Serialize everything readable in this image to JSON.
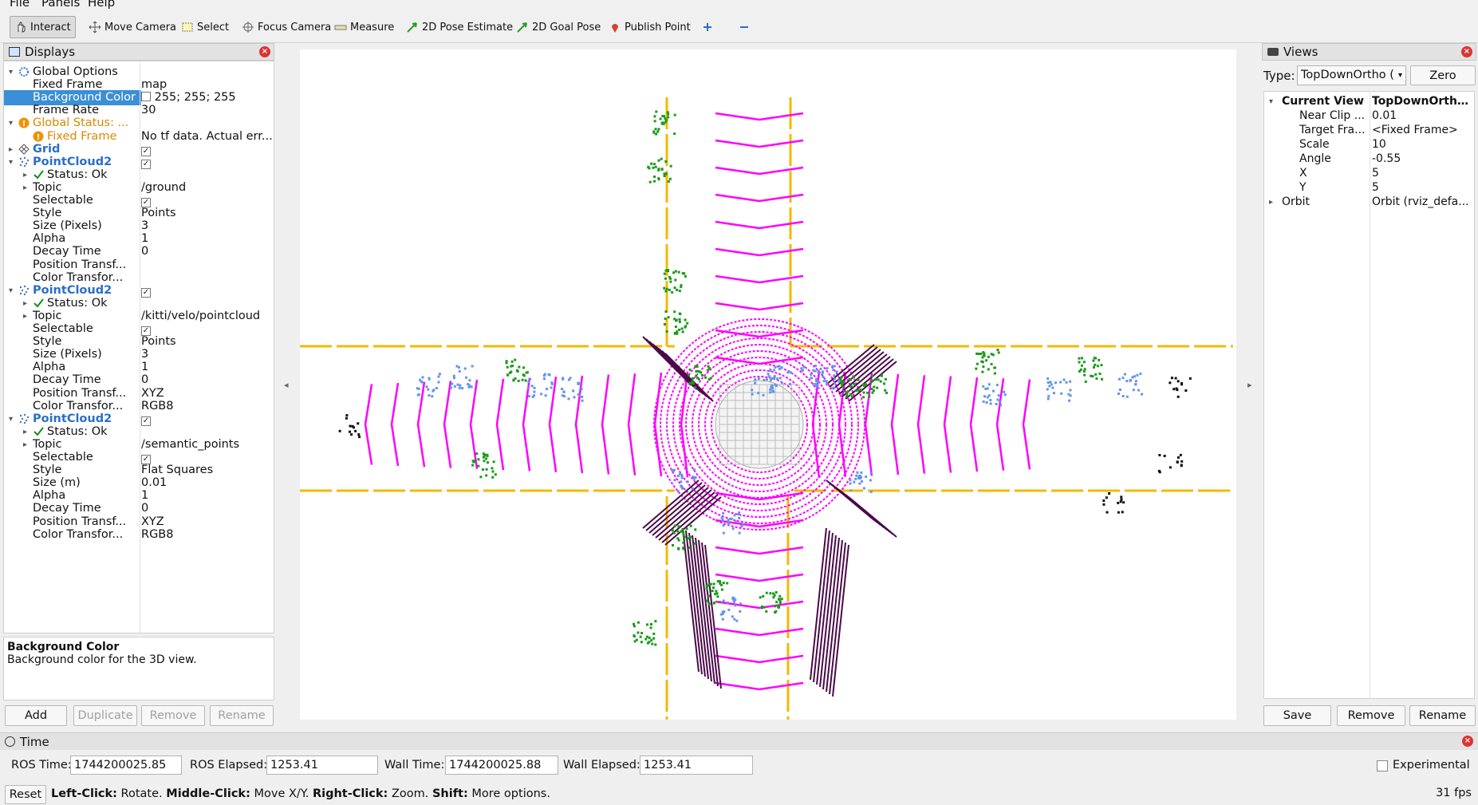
{
  "menu": [
    "File",
    "Panels",
    "Help"
  ],
  "toolbar": {
    "interact": "Interact",
    "move_camera": "Move Camera",
    "select": "Select",
    "focus_camera": "Focus Camera",
    "measure": "Measure",
    "pose_estimate": "2D Pose Estimate",
    "goal_pose": "2D Goal Pose",
    "publish_point": "Publish Point"
  },
  "displays": {
    "title": "Displays",
    "rows": [
      {
        "label": "Global Options",
        "value": ""
      },
      {
        "label": "Fixed Frame",
        "value": "map"
      },
      {
        "label": "Background Color",
        "value": "255; 255; 255"
      },
      {
        "label": "Frame Rate",
        "value": "30"
      },
      {
        "label": "Global Status: ...",
        "value": ""
      },
      {
        "label": "Fixed Frame",
        "value": "No tf data.  Actual err..."
      },
      {
        "label": "Grid",
        "value": ""
      },
      {
        "label": "PointCloud2",
        "value": ""
      },
      {
        "label": "Status: Ok",
        "value": ""
      },
      {
        "label": "Topic",
        "value": "/ground"
      },
      {
        "label": "Selectable",
        "value": ""
      },
      {
        "label": "Style",
        "value": "Points"
      },
      {
        "label": "Size (Pixels)",
        "value": "3"
      },
      {
        "label": "Alpha",
        "value": "1"
      },
      {
        "label": "Decay Time",
        "value": "0"
      },
      {
        "label": "Position Transf...",
        "value": ""
      },
      {
        "label": "Color Transfor...",
        "value": ""
      },
      {
        "label": "PointCloud2",
        "value": ""
      },
      {
        "label": "Status: Ok",
        "value": ""
      },
      {
        "label": "Topic",
        "value": "/kitti/velo/pointcloud"
      },
      {
        "label": "Selectable",
        "value": ""
      },
      {
        "label": "Style",
        "value": "Points"
      },
      {
        "label": "Size (Pixels)",
        "value": "3"
      },
      {
        "label": "Alpha",
        "value": "1"
      },
      {
        "label": "Decay Time",
        "value": "0"
      },
      {
        "label": "Position Transf...",
        "value": "XYZ"
      },
      {
        "label": "Color Transfor...",
        "value": "RGB8"
      },
      {
        "label": "PointCloud2",
        "value": ""
      },
      {
        "label": "Status: Ok",
        "value": ""
      },
      {
        "label": "Topic",
        "value": "/semantic_points"
      },
      {
        "label": "Selectable",
        "value": ""
      },
      {
        "label": "Style",
        "value": "Flat Squares"
      },
      {
        "label": "Size (m)",
        "value": "0.01"
      },
      {
        "label": "Alpha",
        "value": "1"
      },
      {
        "label": "Decay Time",
        "value": "0"
      },
      {
        "label": "Position Transf...",
        "value": "XYZ"
      },
      {
        "label": "Color Transfor...",
        "value": "RGB8"
      }
    ],
    "description_title": "Background Color",
    "description_text": "Background color for the 3D view.",
    "buttons": {
      "add": "Add",
      "duplicate": "Duplicate",
      "remove": "Remove",
      "rename": "Rename"
    }
  },
  "views": {
    "title": "Views",
    "type_label": "Type:",
    "type_value": "TopDownOrtho (",
    "zero": "Zero",
    "rows": [
      {
        "label": "Current View",
        "value": "TopDownOrtho ..."
      },
      {
        "label": "Near Clip ...",
        "value": "0.01"
      },
      {
        "label": "Target Fra...",
        "value": "<Fixed Frame>"
      },
      {
        "label": "Scale",
        "value": "10"
      },
      {
        "label": "Angle",
        "value": "-0.55"
      },
      {
        "label": "X",
        "value": "5"
      },
      {
        "label": "Y",
        "value": "5"
      },
      {
        "label": "Orbit",
        "value": "Orbit (rviz_defa..."
      }
    ],
    "buttons": {
      "save": "Save",
      "remove": "Remove",
      "rename": "Rename"
    }
  },
  "time": {
    "title": "Time",
    "ros_time_label": "ROS Time:",
    "ros_time": "1744200025.85",
    "ros_elapsed_label": "ROS Elapsed:",
    "ros_elapsed": "1253.41",
    "wall_time_label": "Wall Time:",
    "wall_time": "1744200025.88",
    "wall_elapsed_label": "Wall Elapsed:",
    "wall_elapsed": "1253.41",
    "experimental": "Experimental"
  },
  "status": {
    "reset": "Reset",
    "left_click": "Left-Click:",
    "left_click_desc": " Rotate. ",
    "middle_click": "Middle-Click:",
    "middle_click_desc": " Move X/Y. ",
    "right_click": "Right-Click:",
    "right_click_desc": " Zoom. ",
    "shift": "Shift:",
    "shift_desc": " More options.",
    "fps": "31 fps"
  },
  "colors": {
    "selection": "#3b8fd6",
    "ground": "#ff00ff",
    "road": "#4b0a4a",
    "vegetation": "#1a9a1a",
    "lane": "#f5b800",
    "vehicle": "#6495ed"
  }
}
